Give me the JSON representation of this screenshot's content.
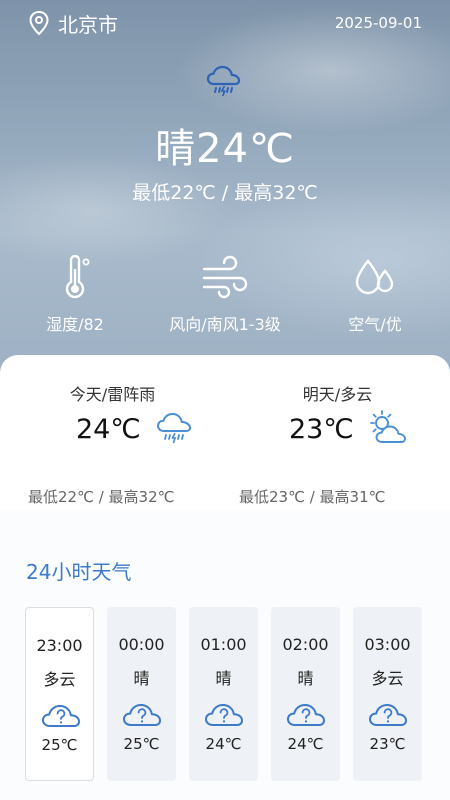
{
  "header": {
    "city": "北京市",
    "date": "2025-09-01"
  },
  "current": {
    "condition_icon": "thunder-rain-cloud-icon",
    "temp_label": "晴24℃",
    "range_label": "最低22℃ / 最高32℃"
  },
  "stats": [
    {
      "icon": "thermometer-icon",
      "label": "湿度/82"
    },
    {
      "icon": "wind-icon",
      "label": "风向/南风1-3级"
    },
    {
      "icon": "water-drops-icon",
      "label": "空气/优"
    }
  ],
  "forecast": {
    "today": {
      "title": "今天/雷阵雨",
      "temp": "24℃",
      "range": "最低22℃ / 最高32℃",
      "icon": "thunder-rain-cloud-icon"
    },
    "tomorrow": {
      "title": "明天/多云",
      "temp": "23℃",
      "range": "最低23℃ / 最高31℃",
      "icon": "partly-cloudy-icon"
    }
  },
  "hourly": {
    "title": "24小时天气",
    "items": [
      {
        "time": "23:00",
        "cond": "多云",
        "temp": "25℃",
        "icon": "unknown-cloud-icon"
      },
      {
        "time": "00:00",
        "cond": "晴",
        "temp": "25℃",
        "icon": "unknown-cloud-icon"
      },
      {
        "time": "01:00",
        "cond": "晴",
        "temp": "24℃",
        "icon": "unknown-cloud-icon"
      },
      {
        "time": "02:00",
        "cond": "晴",
        "temp": "24℃",
        "icon": "unknown-cloud-icon"
      },
      {
        "time": "03:00",
        "cond": "多云",
        "temp": "23℃",
        "icon": "unknown-cloud-icon"
      }
    ]
  },
  "colors": {
    "accent": "#3d7ac9",
    "icon_blue": "#4a8fd6"
  }
}
